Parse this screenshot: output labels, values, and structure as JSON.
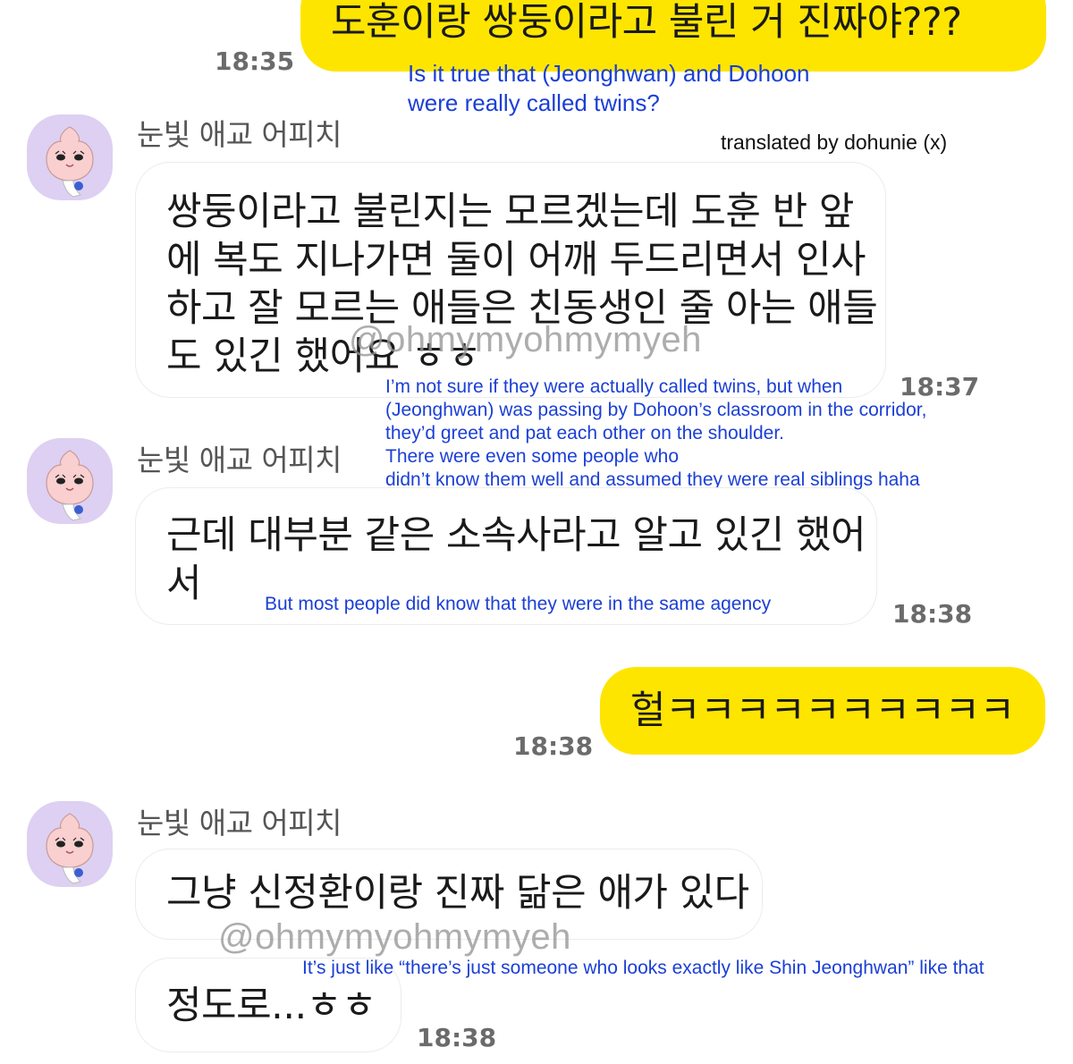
{
  "messages": {
    "m1": {
      "text": "도훈이랑 쌍둥이라고 불린 거 진짜야???",
      "time": "18:35",
      "translation": [
        "Is it true that (Jeonghwan) and Dohoon",
        "were really called twins?"
      ]
    },
    "sender_name": "눈빛 애교 어피치",
    "credit": "translated by dohunie (x)",
    "m2": {
      "lines": [
        "쌍둥이라고 불린지는 모르겠는데 도훈 반 앞",
        "에 복도 지나가면 둘이 어깨 두드리면서 인사",
        "하고 잘 모르는 애들은 친동생인 줄 아는 애들",
        "도 있긴 했어요 ㅎㅎ"
      ],
      "time": "18:37",
      "translation": [
        "I’m not sure if they were actually called twins, but when",
        "(Jeonghwan) was passing by Dohoon’s classroom in the corridor,",
        "they’d greet and pat each other on the shoulder.",
        "There were even some people who",
        "didn’t know them well and assumed they were real siblings haha"
      ]
    },
    "m3": {
      "lines": [
        "근데 대부분 같은 소속사라고 알고 있긴 했어",
        "서"
      ],
      "time": "18:38",
      "translation": "But most people did know that they were in the same agency"
    },
    "m4": {
      "text": "헐ㅋㅋㅋㅋㅋㅋㅋㅋㅋㅋ",
      "time": "18:38"
    },
    "m5": {
      "text": "그냥 신정환이랑 진짜 닮은 애가 있다"
    },
    "m6": {
      "text": "정도로...ㅎㅎ",
      "time": "18:38",
      "translation": "It’s just like “there’s just someone who looks exactly like Shin Jeonghwan” like that"
    },
    "watermark": "@ohmymyohmymyeh"
  },
  "colors": {
    "my_bubble": "#fee500",
    "translation_text": "#1b3fd6",
    "avatar_bg": "#ddd0f2"
  },
  "icons": {
    "avatar": "apeach-avatar-icon"
  }
}
